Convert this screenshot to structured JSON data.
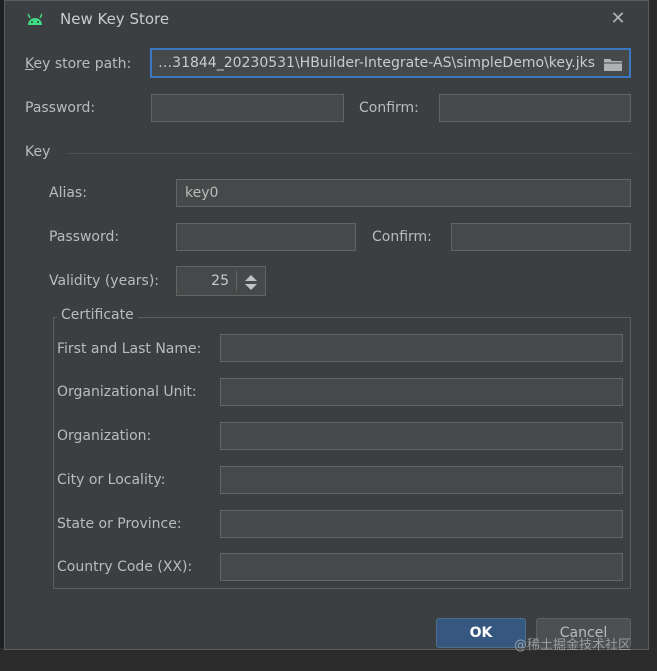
{
  "dialog": {
    "title": "New Key Store",
    "close_glyph": "✕"
  },
  "keystore": {
    "path_label": "Key store path:",
    "path_value": "…31844_20230531\\HBuilder-Integrate-AS\\simpleDemo\\key.jks",
    "password_label": "Password:",
    "confirm_label": "Confirm:"
  },
  "key": {
    "section_title": "Key",
    "alias_label": "Alias:",
    "alias_value": "key0",
    "password_label": "Password:",
    "confirm_label": "Confirm:",
    "validity_label": "Validity (years):",
    "validity_value": "25"
  },
  "certificate": {
    "title": "Certificate",
    "fields": [
      {
        "label": "First and Last Name:",
        "value": ""
      },
      {
        "label": "Organizational Unit:",
        "value": ""
      },
      {
        "label": "Organization:",
        "value": ""
      },
      {
        "label": "City or Locality:",
        "value": ""
      },
      {
        "label": "State or Province:",
        "value": ""
      },
      {
        "label": "Country Code (XX):",
        "value": ""
      }
    ]
  },
  "buttons": {
    "ok": "OK",
    "cancel": "Cancel"
  },
  "watermark": "@稀土掘金技术社区",
  "icons": {
    "app": "android-icon",
    "browse": "folder-icon",
    "close": "close-icon"
  },
  "colors": {
    "dialog_bg": "#3c3f41",
    "field_bg": "#45494a",
    "focus_border": "#3b78c2",
    "ok_button": "#365880"
  }
}
